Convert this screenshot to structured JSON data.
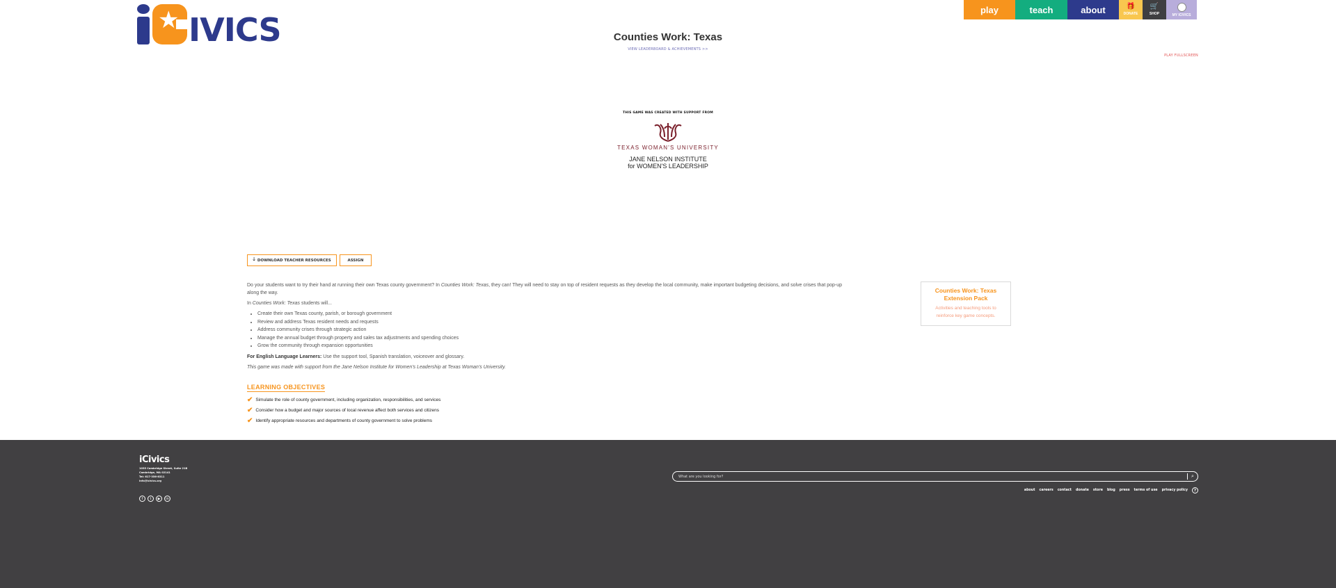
{
  "header": {
    "logo_text": "iCivics",
    "nav": {
      "play": "play",
      "teach": "teach",
      "about": "about",
      "donate": "DONATE",
      "shop": "SHOP",
      "my_icivics": "MY ICIVICS"
    },
    "page_title": "Counties Work: Texas",
    "leaderboard_link": "VIEW LEADERBOARD & ACHIEVEMENTS >>",
    "fullscreen_link": "PLAY FULLSCREEN"
  },
  "sponsor": {
    "label": "THIS GAME WAS CREATED WITH SUPPORT FROM",
    "university": "TEXAS WOMAN'S UNIVERSITY",
    "institute_line1": "JANE NELSON INSTITUTE",
    "institute_line2": "for WOMEN'S LEADERSHIP"
  },
  "buttons": {
    "download": "DOWNLOAD TEACHER RESOURCES",
    "assign": "ASSIGN"
  },
  "description": {
    "intro_a": "Do your students want to try their hand at running their own Texas county government? In ",
    "intro_game": "Counties Work: Texas",
    "intro_b": ", they can! They will need to stay on top of resident requests as they develop the local community, make important budgeting decisions, and solve crises that pop-up along the way.",
    "will_a": "In ",
    "will_game": "Counties Work: Texas",
    "will_b": " students will...",
    "bullets": [
      "Create their own Texas county, parish, or borough government",
      "Review and address Texas resident needs and requests",
      "Address community crises through strategic action",
      "Manage the annual budget through property and sales tax adjustments and spending choices",
      "Grow the community through expansion opportunities"
    ],
    "ell_title": "For English Language Learners:",
    "ell_text": " Use the support tool, Spanish translation, voiceover and glossary.",
    "support_note": "This game was made with support from the Jane Nelson Institute for Women's Leadership at Texas Woman's University."
  },
  "learning_objectives": {
    "title": "LEARNING OBJECTIVES",
    "items": [
      "Simulate the role of county government, including organization, responsibilities, and services",
      "Consider how a budget and major sources of local revenue affect both services and citizens",
      "Identify appropriate resources and departments of county government to solve problems"
    ]
  },
  "extension_pack": {
    "title": "Counties Work: Texas Extension Pack",
    "description": "Activities and teaching tools to reinforce key game concepts."
  },
  "footer": {
    "logo_text": "iCivics",
    "address_line1": "1035 Cambridge Street, Suite 21B",
    "address_line2": "Cambridge, MA 02141",
    "address_line3": "Tel: 617-356-8311",
    "address_line4": "info@icivics.org",
    "search_placeholder": "What are you looking for?",
    "links": [
      "about",
      "careers",
      "contact",
      "donate",
      "store",
      "blog",
      "press",
      "terms of use",
      "privacy policy"
    ],
    "help": "?"
  },
  "colors": {
    "orange": "#f7941d",
    "green": "#13ad7f",
    "navy": "#2d3a8c",
    "footer_bg": "#414042"
  }
}
